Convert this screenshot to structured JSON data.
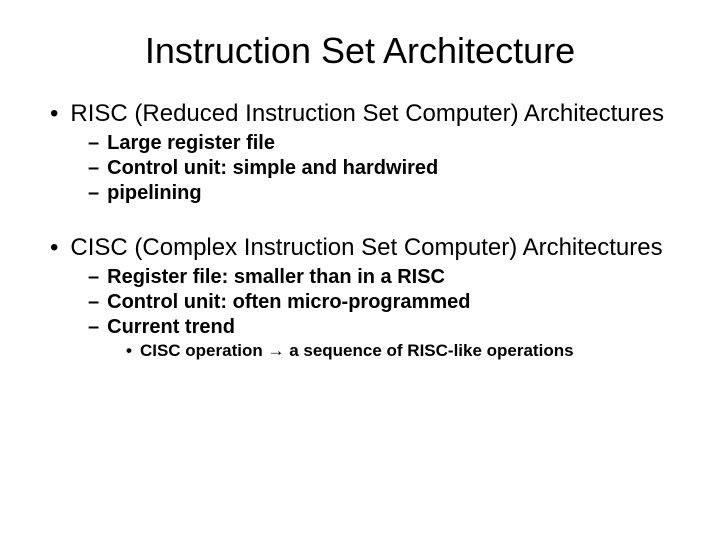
{
  "title": "Instruction Set Architecture",
  "sections": [
    {
      "heading": "RISC (Reduced Instruction Set Computer) Architectures",
      "items": [
        "Large register file",
        "Control unit: simple and hardwired",
        "pipelining"
      ],
      "subitems": []
    },
    {
      "heading": "CISC (Complex Instruction Set Computer) Architectures",
      "items": [
        "Register file: smaller than in a RISC",
        "Control unit: often micro-programmed",
        "Current trend"
      ],
      "subitems": [
        {
          "parent": 2,
          "text_before": "CISC operation ",
          "arrow": "→",
          "text_after": " a sequence of RISC-like operations"
        }
      ]
    }
  ]
}
